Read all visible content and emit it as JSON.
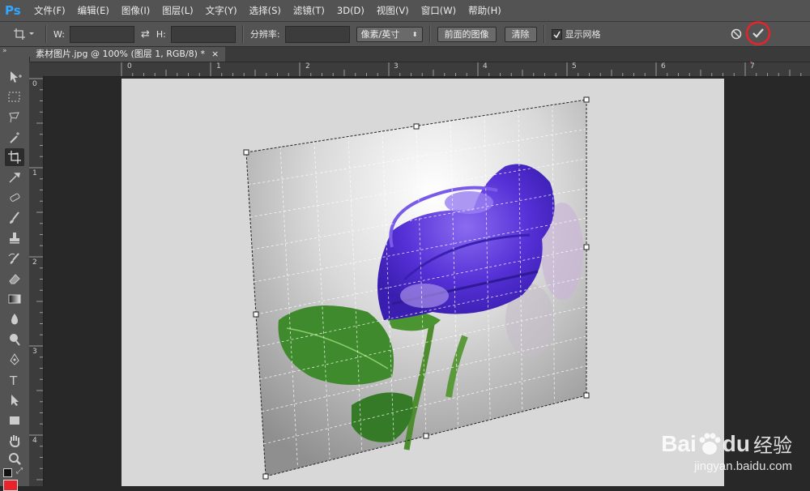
{
  "app": {
    "logo": "Ps"
  },
  "menu": [
    "文件(F)",
    "编辑(E)",
    "图像(I)",
    "图层(L)",
    "文字(Y)",
    "选择(S)",
    "滤镜(T)",
    "3D(D)",
    "视图(V)",
    "窗口(W)",
    "帮助(H)"
  ],
  "options": {
    "w_label": "W:",
    "h_label": "H:",
    "w_value": "",
    "h_value": "",
    "resolution_label": "分辨率:",
    "resolution_value": "",
    "unit_select": "像素/英寸",
    "front_image_button": "前面的图像",
    "clear_button": "清除",
    "show_grid_label": "显示网格",
    "show_grid_checked": true
  },
  "document": {
    "tab_title": "素材图片.jpg @ 100% (图层 1, RGB/8) *",
    "close": "×"
  },
  "rulers": {
    "h_ticks": [
      "0",
      "1",
      "2",
      "3",
      "4",
      "5",
      "6",
      "7"
    ],
    "v_ticks": [
      "0",
      "1",
      "2",
      "3",
      "4"
    ]
  },
  "watermark": {
    "brand": "Bai",
    "brand2": "du",
    "suffix": "经验",
    "url": "jingyan.baidu.com"
  },
  "colors": {
    "accent_red": "#e8232a",
    "ui_bg": "#535353",
    "rose": "#5a32d8",
    "leaf": "#3f8a2c"
  }
}
